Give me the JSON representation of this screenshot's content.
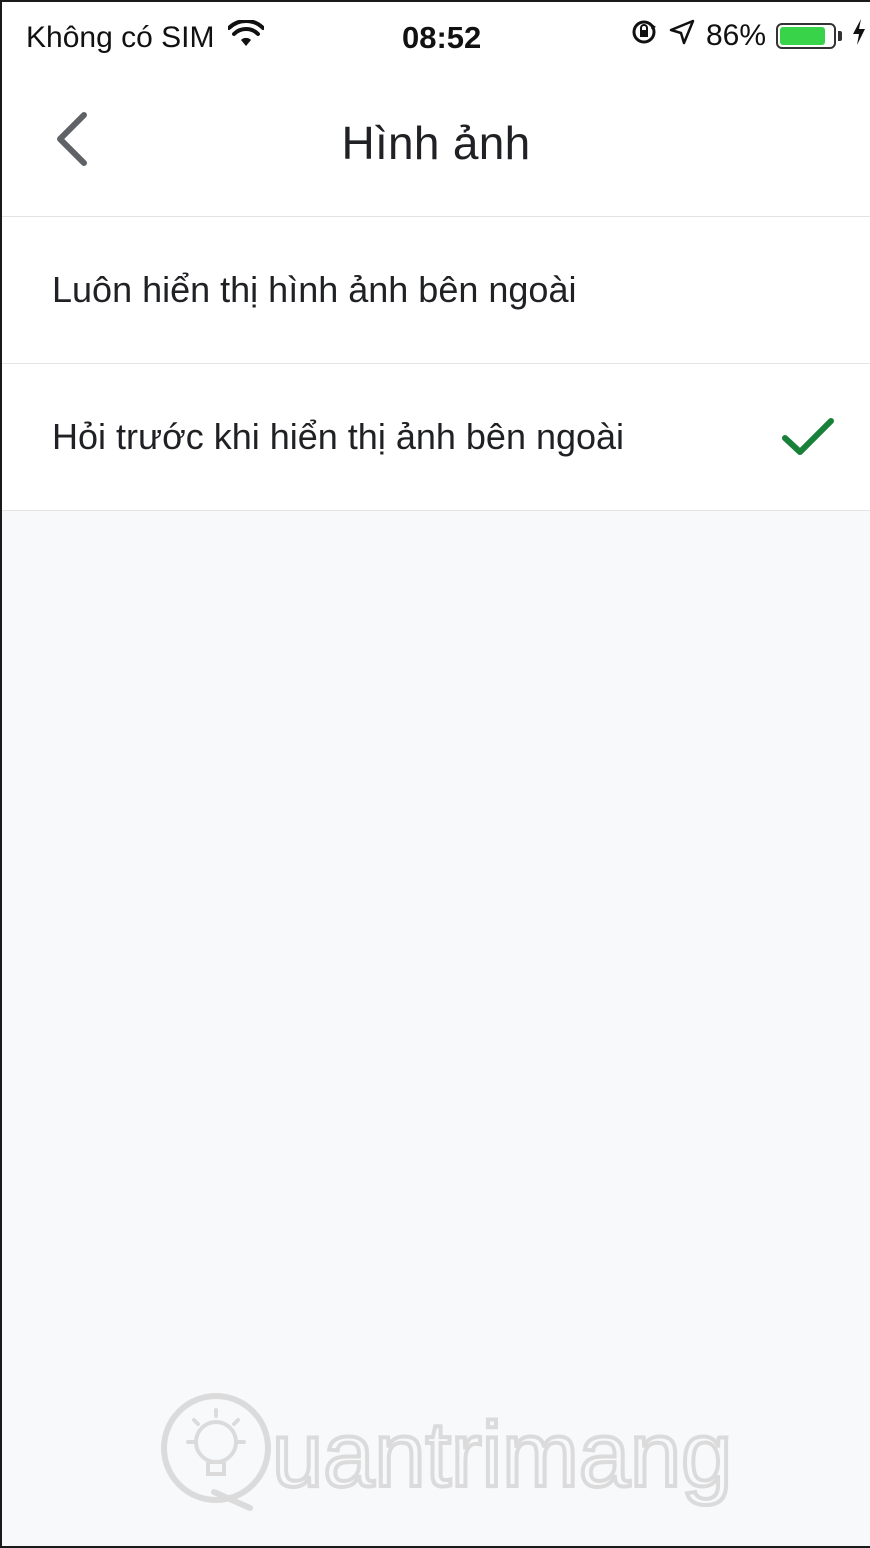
{
  "status_bar": {
    "carrier": "Không có SIM",
    "time": "08:52",
    "battery_percent": "86%",
    "battery_level": 0.86,
    "battery_color": "#39d34a",
    "icons": [
      "wifi-icon",
      "orientation-lock-icon",
      "location-arrow-icon",
      "battery-icon",
      "charging-bolt-icon"
    ]
  },
  "nav": {
    "title": "Hình ảnh",
    "back_icon": "chevron-left-icon"
  },
  "options": [
    {
      "label": "Luôn hiển thị hình ảnh bên ngoài",
      "selected": false
    },
    {
      "label": "Hỏi trước khi hiển thị ảnh bên ngoài",
      "selected": true
    }
  ],
  "accent_color": "#188038",
  "watermark": {
    "text": "uantrimang",
    "icon": "lightbulb-icon"
  }
}
